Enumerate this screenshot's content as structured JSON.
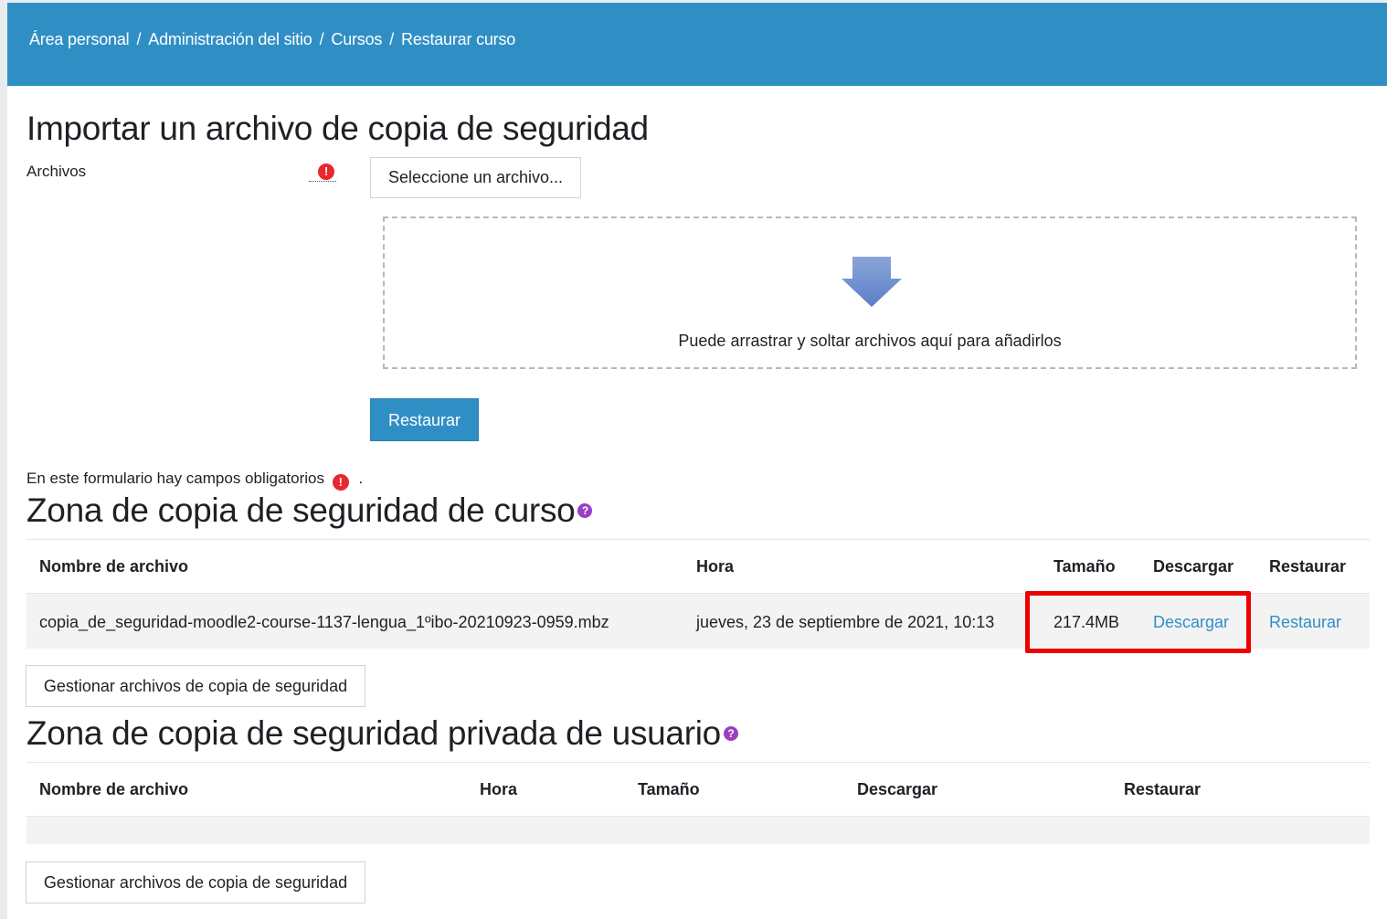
{
  "breadcrumb": {
    "items": [
      "Área personal",
      "Administración del sitio",
      "Cursos",
      "Restaurar curso"
    ],
    "separator": "/"
  },
  "import": {
    "title": "Importar un archivo de copia de seguridad",
    "files_label": "Archivos",
    "select_button": "Seleccione un archivo...",
    "dropzone_text": "Puede arrastrar y soltar archivos aquí para añadirlos",
    "restore_button": "Restaurar",
    "required_note": "En este formulario hay campos obligatorios",
    "required_note_suffix": "."
  },
  "course_zone": {
    "title": "Zona de copia de seguridad de curso",
    "headers": [
      "Nombre de archivo",
      "Hora",
      "Tamaño",
      "Descargar",
      "Restaurar"
    ],
    "rows": [
      {
        "filename": "copia_de_seguridad-moodle2-course-1137-lengua_1ºibo-20210923-0959.mbz",
        "time": "jueves, 23 de septiembre de 2021, 10:13",
        "size": "217.4MB",
        "download": "Descargar",
        "restore": "Restaurar"
      }
    ],
    "manage_button": "Gestionar archivos de copia de seguridad"
  },
  "user_zone": {
    "title": "Zona de copia de seguridad privada de usuario",
    "headers": [
      "Nombre de archivo",
      "Hora",
      "Tamaño",
      "Descargar",
      "Restaurar"
    ],
    "rows": [],
    "manage_button": "Gestionar archivos de copia de seguridad"
  },
  "icons": {
    "required": "exclamation-circle-icon",
    "help": "question-circle-icon",
    "drop_arrow": "arrow-down-icon"
  },
  "colors": {
    "navbar": "#2f8fc5",
    "primary_button": "#2f8fc5",
    "link": "#2f8fc5",
    "required_icon": "#e8282e",
    "help_icon": "#9b3fc1",
    "highlight_box": "#ee0000"
  }
}
